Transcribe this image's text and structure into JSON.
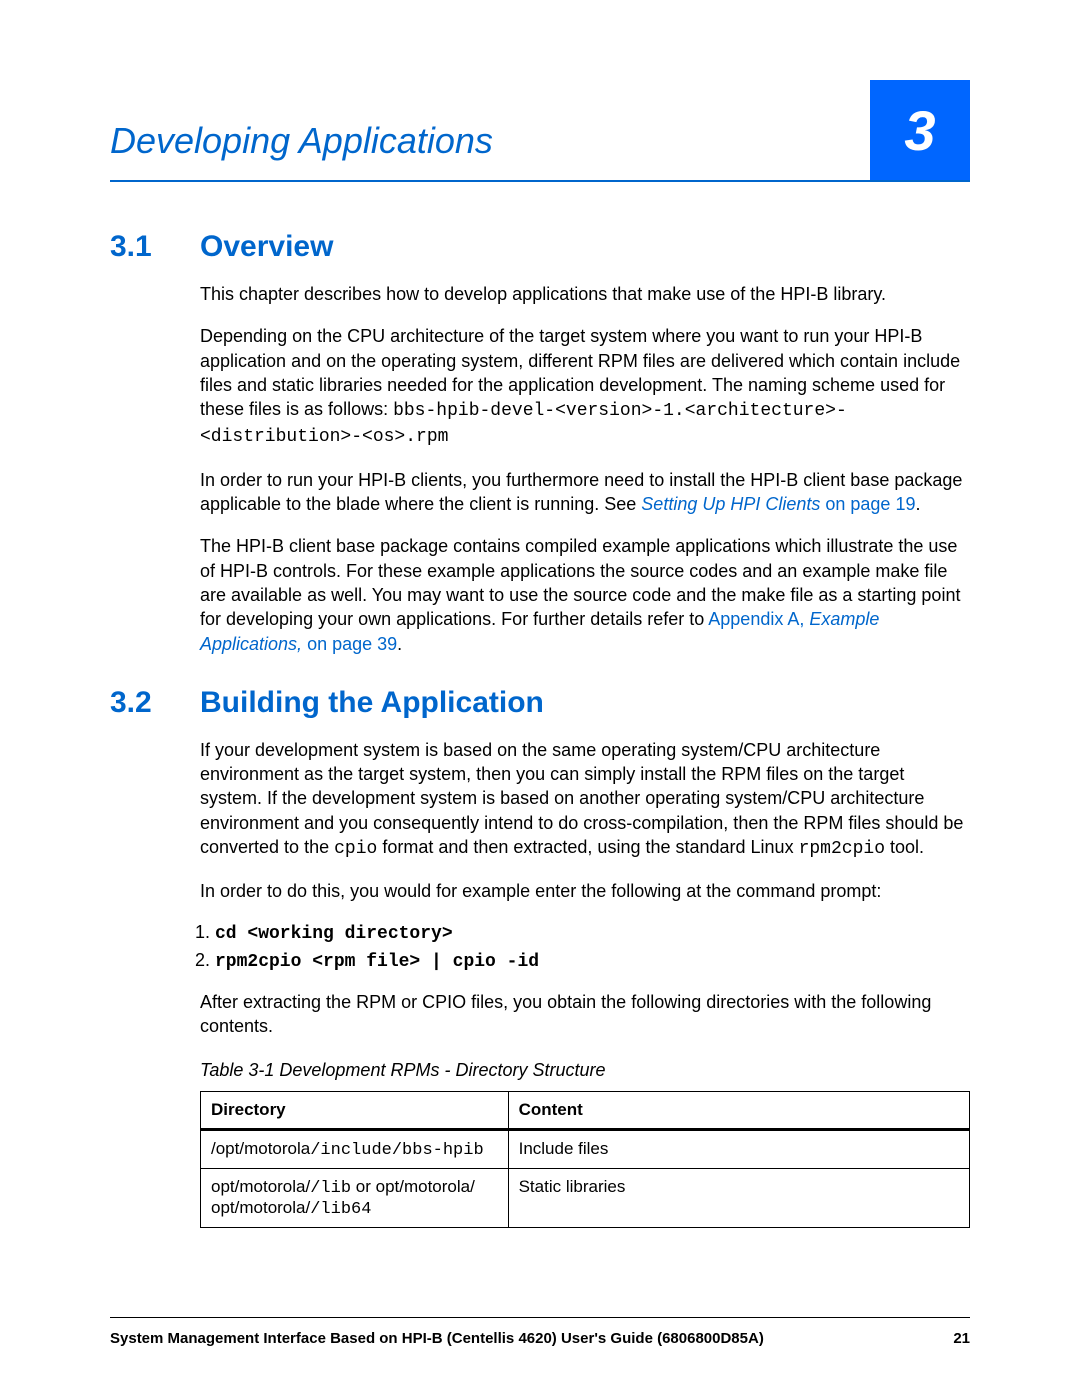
{
  "chapter": {
    "title": "Developing Applications",
    "number": "3"
  },
  "sections": {
    "s1": {
      "num": "3.1",
      "title": "Overview"
    },
    "s2": {
      "num": "3.2",
      "title": "Building the Application"
    }
  },
  "paragraphs": {
    "p1": "This chapter describes how to develop applications that make use of the HPI-B library.",
    "p2a": "Depending on the CPU architecture of the target system where you want to run your HPI-B application and on the operating system, different RPM files are delivered which contain include files and static libraries needed for the application development. The naming scheme used for these files is as follows: ",
    "p2b": "bbs-hpib-devel-<version>-1.<architecture>-<distribution>-<os>.rpm",
    "p3a": "In order to run your HPI-B clients, you furthermore need to install the HPI-B client base package applicable to the blade where the client is running. See ",
    "p3link": "Setting Up HPI Clients",
    "p3b": " on page 19",
    "p3c": ".",
    "p4a": "The HPI-B client base package contains compiled example applications which illustrate the use of HPI-B controls. For these example applications the source codes and an example make file are available as well. You may want to use the source code and the make file as a starting point for developing your own applications. For further details refer to ",
    "p4link1": "Appendix A, ",
    "p4link2": "Example Applications,",
    "p4link3": " on page 39",
    "p4c": ".",
    "p5a": "If your development system is based on the same operating system/CPU architecture environment as the target system, then you can simply install the RPM files on the target system. If the development system is based on another operating system/CPU architecture environment and you consequently intend to do cross-compilation, then the RPM files should be converted to the ",
    "p5code1": "cpio",
    "p5b": " format and then extracted, using the standard Linux ",
    "p5code2": "rpm2cpio",
    "p5c": " tool.",
    "p6": "In order to do this, you would for example enter the following at the command prompt:",
    "p7": "After extracting the RPM or CPIO files, you obtain the following directories with the following contents."
  },
  "commands": {
    "c1": "cd <working directory>",
    "c2": "rpm2cpio <rpm file> | cpio -id"
  },
  "table": {
    "caption": "Table 3-1 Development RPMs - Directory Structure",
    "headers": {
      "h1": "Directory",
      "h2": "Content"
    },
    "rows": [
      {
        "d1a": "/opt/motorola",
        "d1b": "/include/bbs-hpib",
        "c": "Include files"
      },
      {
        "d1a": "opt/motorola/",
        "d1b": "/lib",
        "d1c": "  or opt/motorola/",
        "d1d": "/lib64",
        "c": "Static libraries"
      }
    ]
  },
  "footer": {
    "text": "System Management Interface Based on HPI-B (Centellis 4620) User's Guide (6806800D85A)",
    "page": "21"
  }
}
